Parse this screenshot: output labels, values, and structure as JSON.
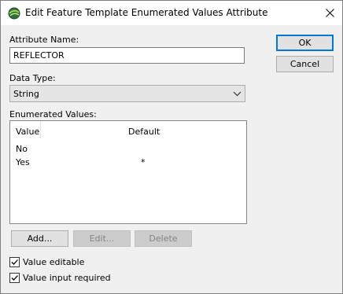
{
  "window": {
    "title": "Edit Feature Template Enumerated Values Attribute",
    "close_icon": "close-icon"
  },
  "form": {
    "attribute_name_label": "Attribute Name:",
    "attribute_name_value": "REFLECTOR",
    "data_type_label": "Data Type:",
    "data_type_value": "String",
    "enum_label": "Enumerated Values:"
  },
  "list": {
    "columns": [
      "Value",
      "Default"
    ],
    "rows": [
      {
        "value": "No",
        "default": ""
      },
      {
        "value": "Yes",
        "default": "*"
      }
    ]
  },
  "buttons": {
    "ok": "OK",
    "cancel": "Cancel",
    "add": "Add...",
    "edit": "Edit...",
    "delete": "Delete"
  },
  "options": {
    "value_editable": {
      "label": "Value editable",
      "checked": true
    },
    "value_required": {
      "label": "Value input required",
      "checked": true
    }
  }
}
